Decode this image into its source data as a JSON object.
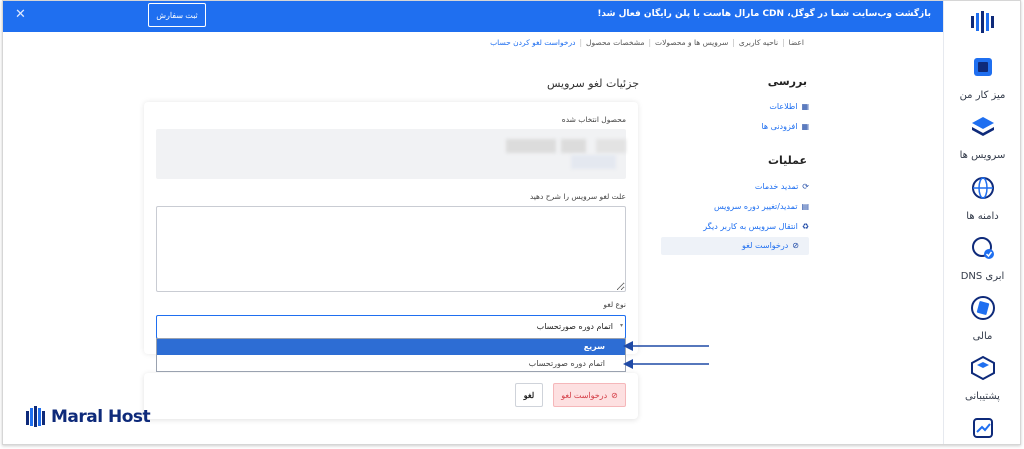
{
  "banner": {
    "text": "بازگشت وب‌سایت شما در گوگل، CDN مارال هاست با پلن رایگان فعال شد!",
    "button_label": "ثبت سفارش",
    "close_glyph": "✕"
  },
  "breadcrumb": [
    {
      "label": "اعضا"
    },
    {
      "label": "ناحیه کاربری"
    },
    {
      "label": "سرویس ها و محصولات"
    },
    {
      "label": "مشخصات محصول"
    },
    {
      "label": "درخواست لغو کردن حساب"
    }
  ],
  "sidebar": {
    "items": [
      {
        "label": "میز کار من",
        "icon": "desk-icon"
      },
      {
        "label": "سرویس ها",
        "icon": "layers-icon"
      },
      {
        "label": "دامنه ها",
        "icon": "globe-icon"
      },
      {
        "label": "DNS ابری",
        "icon": "dns-icon"
      },
      {
        "label": "مالی",
        "icon": "wallet-icon"
      },
      {
        "label": "پشتیبانی",
        "icon": "support-icon"
      }
    ]
  },
  "review_panel": {
    "title": "بررسی",
    "links": [
      "اطلاعات",
      "افزودنی ها"
    ],
    "operations_title": "عملیات",
    "operations": [
      "تمدید خدمات",
      "تمدید/تغییر دوره سرویس",
      "انتقال سرویس به کاربر دیگر",
      "درخواست لغو"
    ]
  },
  "main": {
    "title": "جزئیات لغو سرویس",
    "product_label": "محصول انتخاب شده",
    "reason_label": "علت لغو سرویس را شرح دهید",
    "type_label": "نوع لغو",
    "type_value": "اتمام دوره صورتحساب",
    "options": [
      "سریع",
      "اتمام دوره صورتحساب"
    ]
  },
  "footer": {
    "request_button": "درخواست لغو",
    "cancel_button": "لغو"
  },
  "brand": {
    "name": "Maral Host"
  },
  "colors": {
    "accent": "#1f6ff0",
    "danger": "#d43b45",
    "selected_option": "#2d6dd4"
  }
}
